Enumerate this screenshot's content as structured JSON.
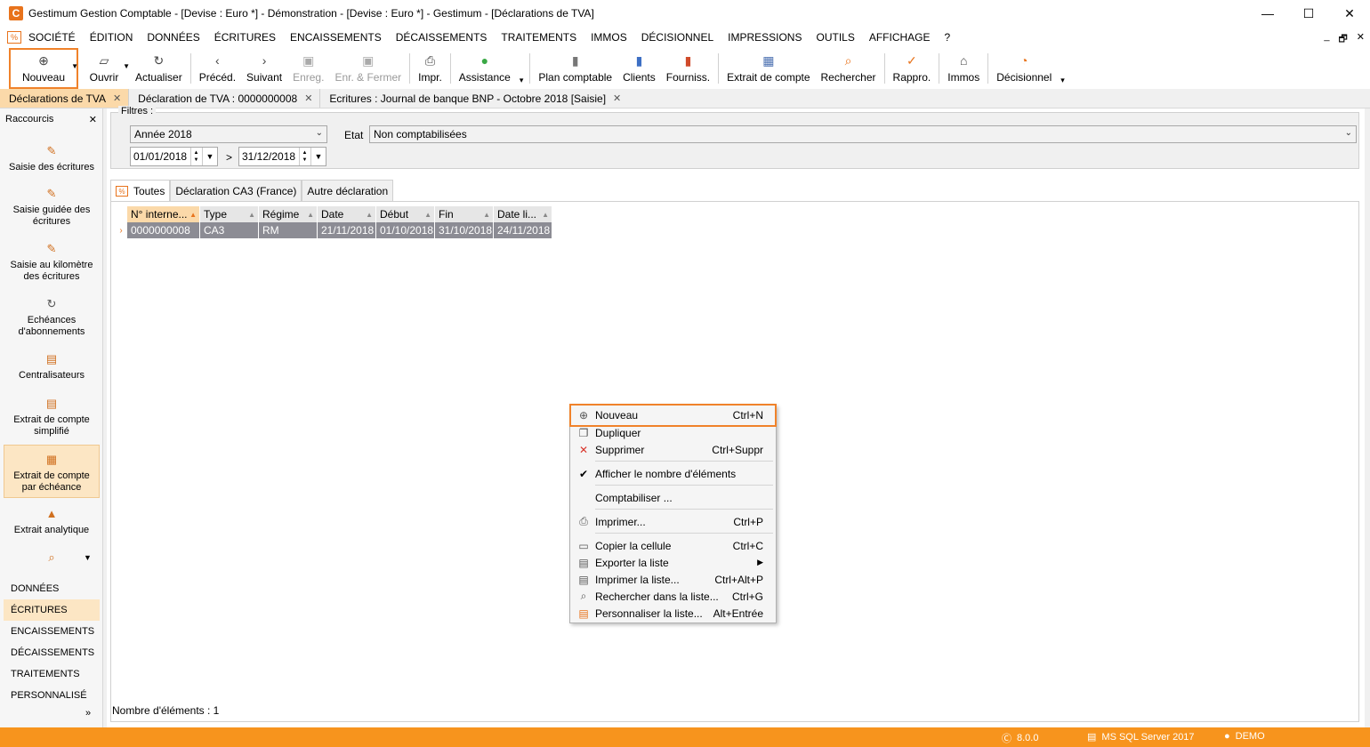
{
  "window": {
    "title": "Gestimum Gestion Comptable - [Devise : Euro *] - Démonstration - [Devise : Euro *] - Gestimum - [Déclarations de TVA]",
    "logo_letter": "C",
    "controls": {
      "minimize": "—",
      "maximize": "☐",
      "close": "✕"
    }
  },
  "menubar": {
    "items": [
      "SOCIÉTÉ",
      "ÉDITION",
      "DONNÉES",
      "ÉCRITURES",
      "ENCAISSEMENTS",
      "DÉCAISSEMENTS",
      "TRAITEMENTS",
      "IMMOS",
      "DÉCISIONNEL",
      "IMPRESSIONS",
      "OUTILS",
      "AFFICHAGE",
      "?"
    ],
    "mdi_controls": {
      "minimize": "_",
      "restore": "🗗",
      "close": "✕"
    }
  },
  "toolbar": {
    "nouveau": "Nouveau",
    "ouvrir": "Ouvrir",
    "actualiser": "Actualiser",
    "precedent": "Précéd.",
    "suivant": "Suivant",
    "enregistrer": "Enreg.",
    "enr_fermer": "Enr. & Fermer",
    "imprimer": "Impr.",
    "assistance": "Assistance",
    "plan_comptable": "Plan comptable",
    "clients": "Clients",
    "fournisseurs": "Fourniss.",
    "extrait_compte": "Extrait de compte",
    "rechercher": "Rechercher",
    "rappro": "Rappro.",
    "immos": "Immos",
    "decisionnel": "Décisionnel"
  },
  "doc_tabs": [
    {
      "label": "Déclarations de TVA",
      "active": true
    },
    {
      "label": "Déclaration de TVA : 0000000008",
      "active": false
    },
    {
      "label": "Ecritures : Journal de banque BNP - Octobre 2018 [Saisie]",
      "active": false
    }
  ],
  "sidebar": {
    "header": "Raccourcis",
    "shortcuts": [
      "Saisie des écritures",
      "Saisie guidée des écritures",
      "Saisie au kilomètre des écritures",
      "Echéances d'abonnements",
      "Centralisateurs",
      "Extrait de compte simplifié",
      "Extrait de compte par échéance",
      "Extrait analytique"
    ],
    "categories": [
      "DONNÉES",
      "ÉCRITURES",
      "ENCAISSEMENTS",
      "DÉCAISSEMENTS",
      "TRAITEMENTS",
      "PERSONNALISÉ"
    ],
    "active_category": "ÉCRITURES",
    "expand": "»"
  },
  "filters": {
    "legend": "Filtres :",
    "period": "Année 2018",
    "date_from": "01/01/2018",
    "date_to": "31/12/2018",
    "range_sep": ">",
    "etat_label": "Etat",
    "etat_value": "Non comptabilisées"
  },
  "view_tabs": [
    "Toutes",
    "Déclaration CA3 (France)",
    "Autre déclaration"
  ],
  "grid": {
    "columns": [
      "N° interne...",
      "Type",
      "Régime",
      "Date",
      "Début",
      "Fin",
      "Date li..."
    ],
    "rows": [
      [
        "0000000008",
        "CA3",
        "RM",
        "21/11/2018",
        "01/10/2018",
        "31/10/2018",
        "24/11/2018"
      ]
    ]
  },
  "count_label": "Nombre d'éléments : 1",
  "context_menu": {
    "nouveau": {
      "label": "Nouveau",
      "shortcut": "Ctrl+N"
    },
    "dupliquer": {
      "label": "Dupliquer",
      "shortcut": ""
    },
    "supprimer": {
      "label": "Supprimer",
      "shortcut": "Ctrl+Suppr"
    },
    "afficher_nombre": {
      "label": "Afficher le nombre d'éléments",
      "shortcut": ""
    },
    "comptabiliser": {
      "label": "Comptabiliser ...",
      "shortcut": ""
    },
    "imprimer": {
      "label": "Imprimer...",
      "shortcut": "Ctrl+P"
    },
    "copier_cellule": {
      "label": "Copier la cellule",
      "shortcut": "Ctrl+C"
    },
    "exporter_liste": {
      "label": "Exporter la liste",
      "shortcut": ""
    },
    "imprimer_liste": {
      "label": "Imprimer la liste...",
      "shortcut": "Ctrl+Alt+P"
    },
    "rechercher_liste": {
      "label": "Rechercher dans la liste...",
      "shortcut": "Ctrl+G"
    },
    "personnaliser_liste": {
      "label": "Personnaliser la liste...",
      "shortcut": "Alt+Entrée"
    }
  },
  "statusbar": {
    "version": "8.0.0",
    "database": "MS SQL Server 2017",
    "user": "DEMO"
  },
  "colors": {
    "accent": "#f7941d",
    "highlight_outline": "#f0822a",
    "active_tab": "#fbd9a9",
    "selected_row": "#8c8c94"
  }
}
